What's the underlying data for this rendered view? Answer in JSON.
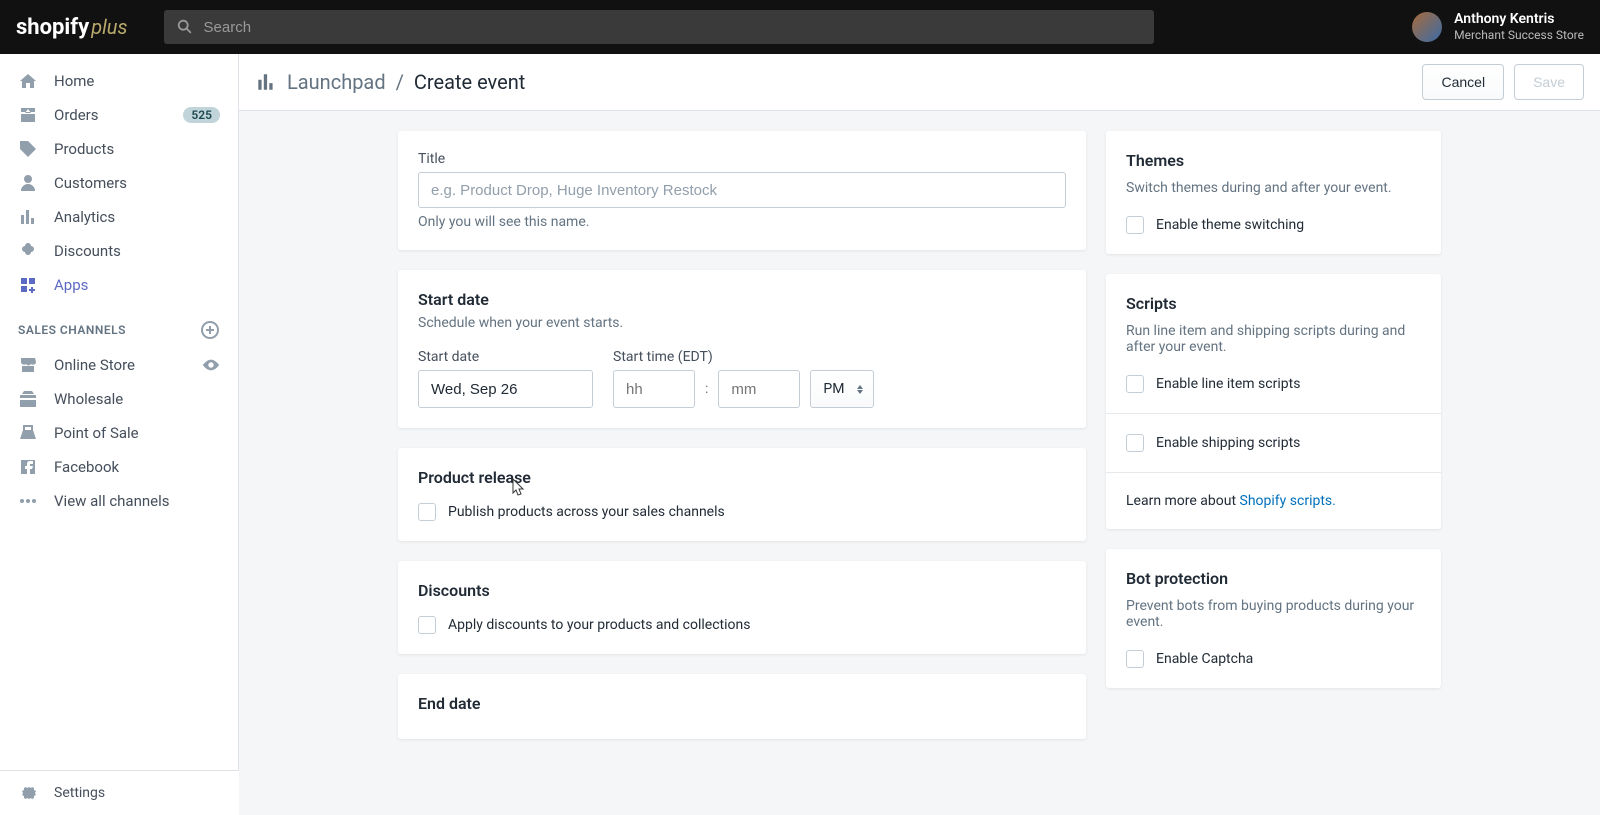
{
  "header": {
    "logo_main": "shopify",
    "logo_sub": "plus",
    "search_placeholder": "Search",
    "user_name": "Anthony Kentris",
    "user_store": "Merchant Success Store"
  },
  "sidebar": {
    "items": [
      {
        "label": "Home"
      },
      {
        "label": "Orders",
        "badge": "525"
      },
      {
        "label": "Products"
      },
      {
        "label": "Customers"
      },
      {
        "label": "Analytics"
      },
      {
        "label": "Discounts"
      },
      {
        "label": "Apps",
        "active": true
      }
    ],
    "section_title": "Sales Channels",
    "channels": [
      {
        "label": "Online Store",
        "eye": true
      },
      {
        "label": "Wholesale"
      },
      {
        "label": "Point of Sale"
      },
      {
        "label": "Facebook"
      },
      {
        "label": "View all channels"
      }
    ],
    "settings": "Settings"
  },
  "page": {
    "breadcrumb_app": "Launchpad",
    "breadcrumb_sep": "/",
    "breadcrumb_current": "Create event",
    "cancel": "Cancel",
    "save": "Save"
  },
  "card_title": {
    "label": "Title",
    "placeholder": "e.g. Product Drop, Huge Inventory Restock",
    "hint": "Only you will see this name."
  },
  "card_start": {
    "heading": "Start date",
    "sub": "Schedule when your event starts.",
    "date_label": "Start date",
    "date_value": "Wed, Sep 26",
    "time_label": "Start time (EDT)",
    "hh_placeholder": "hh",
    "mm_placeholder": "mm",
    "ampm": "PM",
    "colon": ":"
  },
  "card_product": {
    "heading": "Product release",
    "check": "Publish products across your sales channels"
  },
  "card_discounts": {
    "heading": "Discounts",
    "check": "Apply discounts to your products and collections"
  },
  "card_end": {
    "heading": "End date"
  },
  "card_themes": {
    "heading": "Themes",
    "sub": "Switch themes during and after your event.",
    "check": "Enable theme switching"
  },
  "card_scripts": {
    "heading": "Scripts",
    "sub": "Run line item and shipping scripts during and after your event.",
    "check1": "Enable line item scripts",
    "check2": "Enable shipping scripts",
    "learn_prefix": "Learn more about ",
    "learn_link": "Shopify scripts."
  },
  "card_bot": {
    "heading": "Bot protection",
    "sub": "Prevent bots from buying products during your event.",
    "check": "Enable Captcha"
  }
}
